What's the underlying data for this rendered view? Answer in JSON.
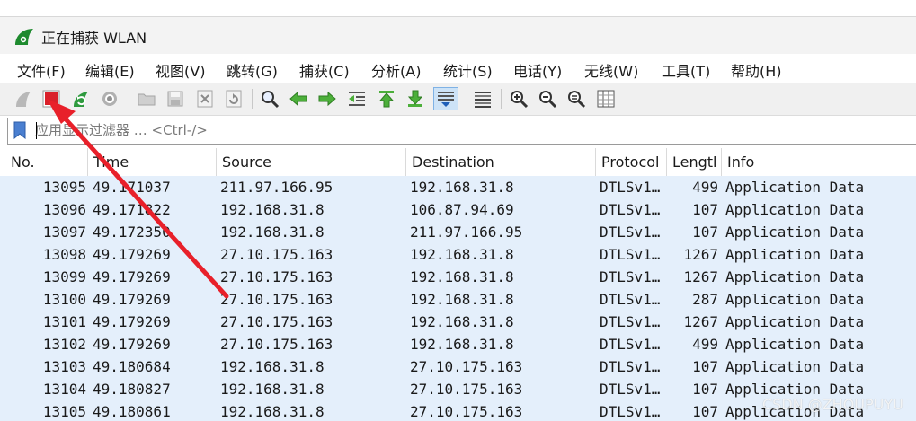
{
  "window": {
    "title": "正在捕获 WLAN"
  },
  "menu": {
    "items": [
      "文件(F)",
      "编辑(E)",
      "视图(V)",
      "跳转(G)",
      "捕获(C)",
      "分析(A)",
      "统计(S)",
      "电话(Y)",
      "无线(W)",
      "工具(T)",
      "帮助(H)"
    ]
  },
  "toolbar": {
    "icons": [
      "start-capture-icon",
      "stop-capture-icon",
      "restart-capture-icon",
      "capture-options-icon",
      "open-file-icon",
      "save-file-icon",
      "close-file-icon",
      "reload-file-icon",
      "find-packet-icon",
      "go-back-icon",
      "go-forward-icon",
      "go-to-packet-icon",
      "go-first-icon",
      "go-last-icon",
      "auto-scroll-icon",
      "colorize-icon",
      "zoom-in-icon",
      "zoom-out-icon",
      "zoom-normal-icon",
      "resize-columns-icon"
    ]
  },
  "filter": {
    "placeholder": "应用显示过滤器 … <Ctrl-/>"
  },
  "table": {
    "columns": [
      "No.",
      "Time",
      "Source",
      "Destination",
      "Protocol",
      "Lengtl",
      "Info"
    ],
    "rows": [
      [
        "13095",
        "49.171037",
        "211.97.166.95",
        "192.168.31.8",
        "DTLSv1…",
        "499",
        "Application Data"
      ],
      [
        "13096",
        "49.171822",
        "192.168.31.8",
        "106.87.94.69",
        "DTLSv1…",
        "107",
        "Application Data"
      ],
      [
        "13097",
        "49.172350",
        "192.168.31.8",
        "211.97.166.95",
        "DTLSv1…",
        "107",
        "Application Data"
      ],
      [
        "13098",
        "49.179269",
        "27.10.175.163",
        "192.168.31.8",
        "DTLSv1…",
        "1267",
        "Application Data"
      ],
      [
        "13099",
        "49.179269",
        "27.10.175.163",
        "192.168.31.8",
        "DTLSv1…",
        "1267",
        "Application Data"
      ],
      [
        "13100",
        "49.179269",
        "27.10.175.163",
        "192.168.31.8",
        "DTLSv1…",
        "287",
        "Application Data"
      ],
      [
        "13101",
        "49.179269",
        "27.10.175.163",
        "192.168.31.8",
        "DTLSv1…",
        "1267",
        "Application Data"
      ],
      [
        "13102",
        "49.179269",
        "27.10.175.163",
        "192.168.31.8",
        "DTLSv1…",
        "499",
        "Application Data"
      ],
      [
        "13103",
        "49.180684",
        "192.168.31.8",
        "27.10.175.163",
        "DTLSv1…",
        "107",
        "Application Data"
      ],
      [
        "13104",
        "49.180827",
        "192.168.31.8",
        "27.10.175.163",
        "DTLSv1…",
        "107",
        "Application Data"
      ],
      [
        "13105",
        "49.180861",
        "192.168.31.8",
        "27.10.175.163",
        "DTLSv1…",
        "107",
        "Application Data"
      ]
    ]
  },
  "colors": {
    "row_background": "#e4effb",
    "annotation_arrow": "#e8202a",
    "stop_button": "#d9202a"
  },
  "watermark": "CSDN @ZHOUPUYU"
}
